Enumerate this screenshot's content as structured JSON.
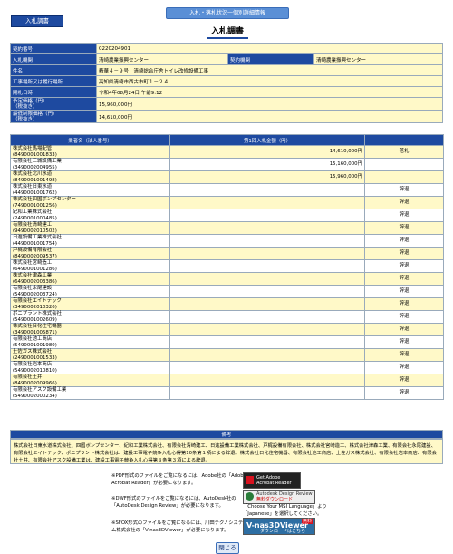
{
  "header": {
    "title": "入札・落札状況一個別詳細情報",
    "kind_badge": "入札調書",
    "page_title": "入札調書"
  },
  "info": {
    "contract_no_label": "契約番号",
    "contract_no": "0220204901",
    "bid_agency_label": "入札機関",
    "bid_agency": "清崎農業振興センター",
    "contract_agency_label": "契約機関",
    "contract_agency": "清崎農業振興センター",
    "work_name_label": "件名",
    "work_name": "精華４－９号　清崎総合庁舎トイレ改修設備工事",
    "location_label": "工事場所又は履行場所",
    "location": "高知県清崎市西古市町１－２４",
    "date_label": "開札日時",
    "date": "令和4年08月24日 午前9:12",
    "estimate_label": "予定価格（円）\n（税抜き）",
    "estimate": "15,960,000円",
    "min_label": "最低制限価格（円）\n（税抜き）",
    "min": "14,610,000円"
  },
  "bids_header": {
    "name_col": "業者名（法人番号）",
    "amount_col": "第1回入札金額（円）",
    "result_col": ""
  },
  "bids": [
    {
      "name": "株式会社馬場配管",
      "num": "(8490001001833)",
      "amount": "14,610,000円",
      "result": "落札"
    },
    {
      "name": "有限会社三城設備工業",
      "num": "(3490002004955)",
      "amount": "15,160,000円",
      "result": ""
    },
    {
      "name": "株式会社北川水道",
      "num": "(8490001001498)",
      "amount": "15,960,000円",
      "result": ""
    },
    {
      "name": "株式会社日東水道",
      "num": "(4490001001762)",
      "amount": "",
      "result": "辞退"
    },
    {
      "name": "株式会社四国ボンプセンター",
      "num": "(7490001001256)",
      "amount": "",
      "result": "辞退"
    },
    {
      "name": "紀和工業株式会社",
      "num": "(2490001000485)",
      "amount": "",
      "result": "辞退"
    },
    {
      "name": "有限会社清崎建工",
      "num": "(9490002010502)",
      "amount": "",
      "result": "辞退"
    },
    {
      "name": "日進設備工業株式会社",
      "num": "(4490001001754)",
      "amount": "",
      "result": "辞退"
    },
    {
      "name": "戸梶設備有限会社",
      "num": "(8490002009537)",
      "amount": "",
      "result": "辞退"
    },
    {
      "name": "株式会社宮崎造工",
      "num": "(6490001001286)",
      "amount": "",
      "result": "辞退"
    },
    {
      "name": "株式会社津森工業",
      "num": "(6490002003386)",
      "amount": "",
      "result": "辞退"
    },
    {
      "name": "有限会社永尾建設",
      "num": "(5490002003724)",
      "amount": "",
      "result": "辞退"
    },
    {
      "name": "有限会社エイトテック",
      "num": "(3490002010326)",
      "amount": "",
      "result": "辞退"
    },
    {
      "name": "ポニプラント株式会社",
      "num": "(5490001002609)",
      "amount": "",
      "result": "辞退"
    },
    {
      "name": "株式会社日化住宅機器",
      "num": "(3490001005871)",
      "amount": "",
      "result": "辞退"
    },
    {
      "name": "有限会社池工商店",
      "num": "(5490001001980)",
      "amount": "",
      "result": "辞退"
    },
    {
      "name": "土佐ガス株式会社",
      "num": "(2490001001533)",
      "amount": "",
      "result": "辞退"
    },
    {
      "name": "有限会社岩本商店",
      "num": "(5490002010810)",
      "amount": "",
      "result": "辞退"
    },
    {
      "name": "有限会社土井",
      "num": "(8490002009966)",
      "amount": "",
      "result": "辞退"
    },
    {
      "name": "有限会社アスク設備工業",
      "num": "(5490002000234)",
      "amount": "",
      "result": "辞退"
    }
  ],
  "remarks": {
    "label": "備考",
    "text": "株式会社日東水道株式会社、四国ボンプセンター、紀和工業株式会社、有限会社清崎建工、日進設備工業株式会社、戸梶設備有限会社、株式会社宮崎造工、株式会社津森工業、有限会社永尾建設、有限会社エイトテック、ポニプラント株式会社は、建設工事電子競争入札心得第10条第１項による辞退。株式会社日化住宅機器、有限会社池工商店、土佐ガス株式会社、有限会社岩本商店、有限会社土井、有限会社アスク設備工業は、建設工事電子競争入札心得第８条第３項による辞退。"
  },
  "notes": {
    "pdf": "※PDF形式のファイルをご覧になるには、Adobe社の「Adobe Acrobat Reader」が必要になります。",
    "dwf": "※DWF形式のファイルをご覧になるには、AutoDesk社の「AutoDesk Design Review」が必要になります。",
    "sfx": "※SFOX形式のファイルをご覧になるには、川田テクノシステム株式会社の「V-nas3DViewer」が必要になります。",
    "msi": "「Choose Your MSI Language」より「Japanese」を選択してください。"
  },
  "banners": {
    "adobe_1": "Get Adobe",
    "adobe_2": "Acrobat Reader",
    "autodesk_1": "Autodesk Design Review",
    "autodesk_2": "無料ダウンロード",
    "vnas_top": "無料",
    "vnas_main": "V-nas3DViewer",
    "vnas_sub": "ダウンロードはこちら"
  },
  "close_label": "閉じる"
}
